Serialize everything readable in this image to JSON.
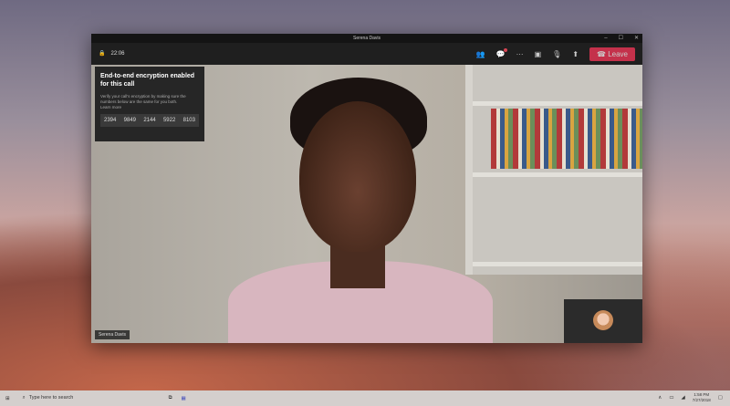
{
  "window": {
    "title": "Serena Davis",
    "minimize": "–",
    "maximize": "☐",
    "close": "✕"
  },
  "toolbar": {
    "timer": "22:06",
    "leave_label": "Leave"
  },
  "encryption": {
    "title": "End-to-end encryption enabled for this call",
    "description": "Verify your call's encryption by making sure the numbers below are the same for you both.",
    "learn_more": "Learn more",
    "codes": [
      "2394",
      "9849",
      "2144",
      "5922",
      "8103"
    ]
  },
  "participant": {
    "name": "Serena Davis"
  },
  "taskbar": {
    "search_placeholder": "Type here to search",
    "time": "1:58 PM",
    "date": "7/27/2018"
  }
}
